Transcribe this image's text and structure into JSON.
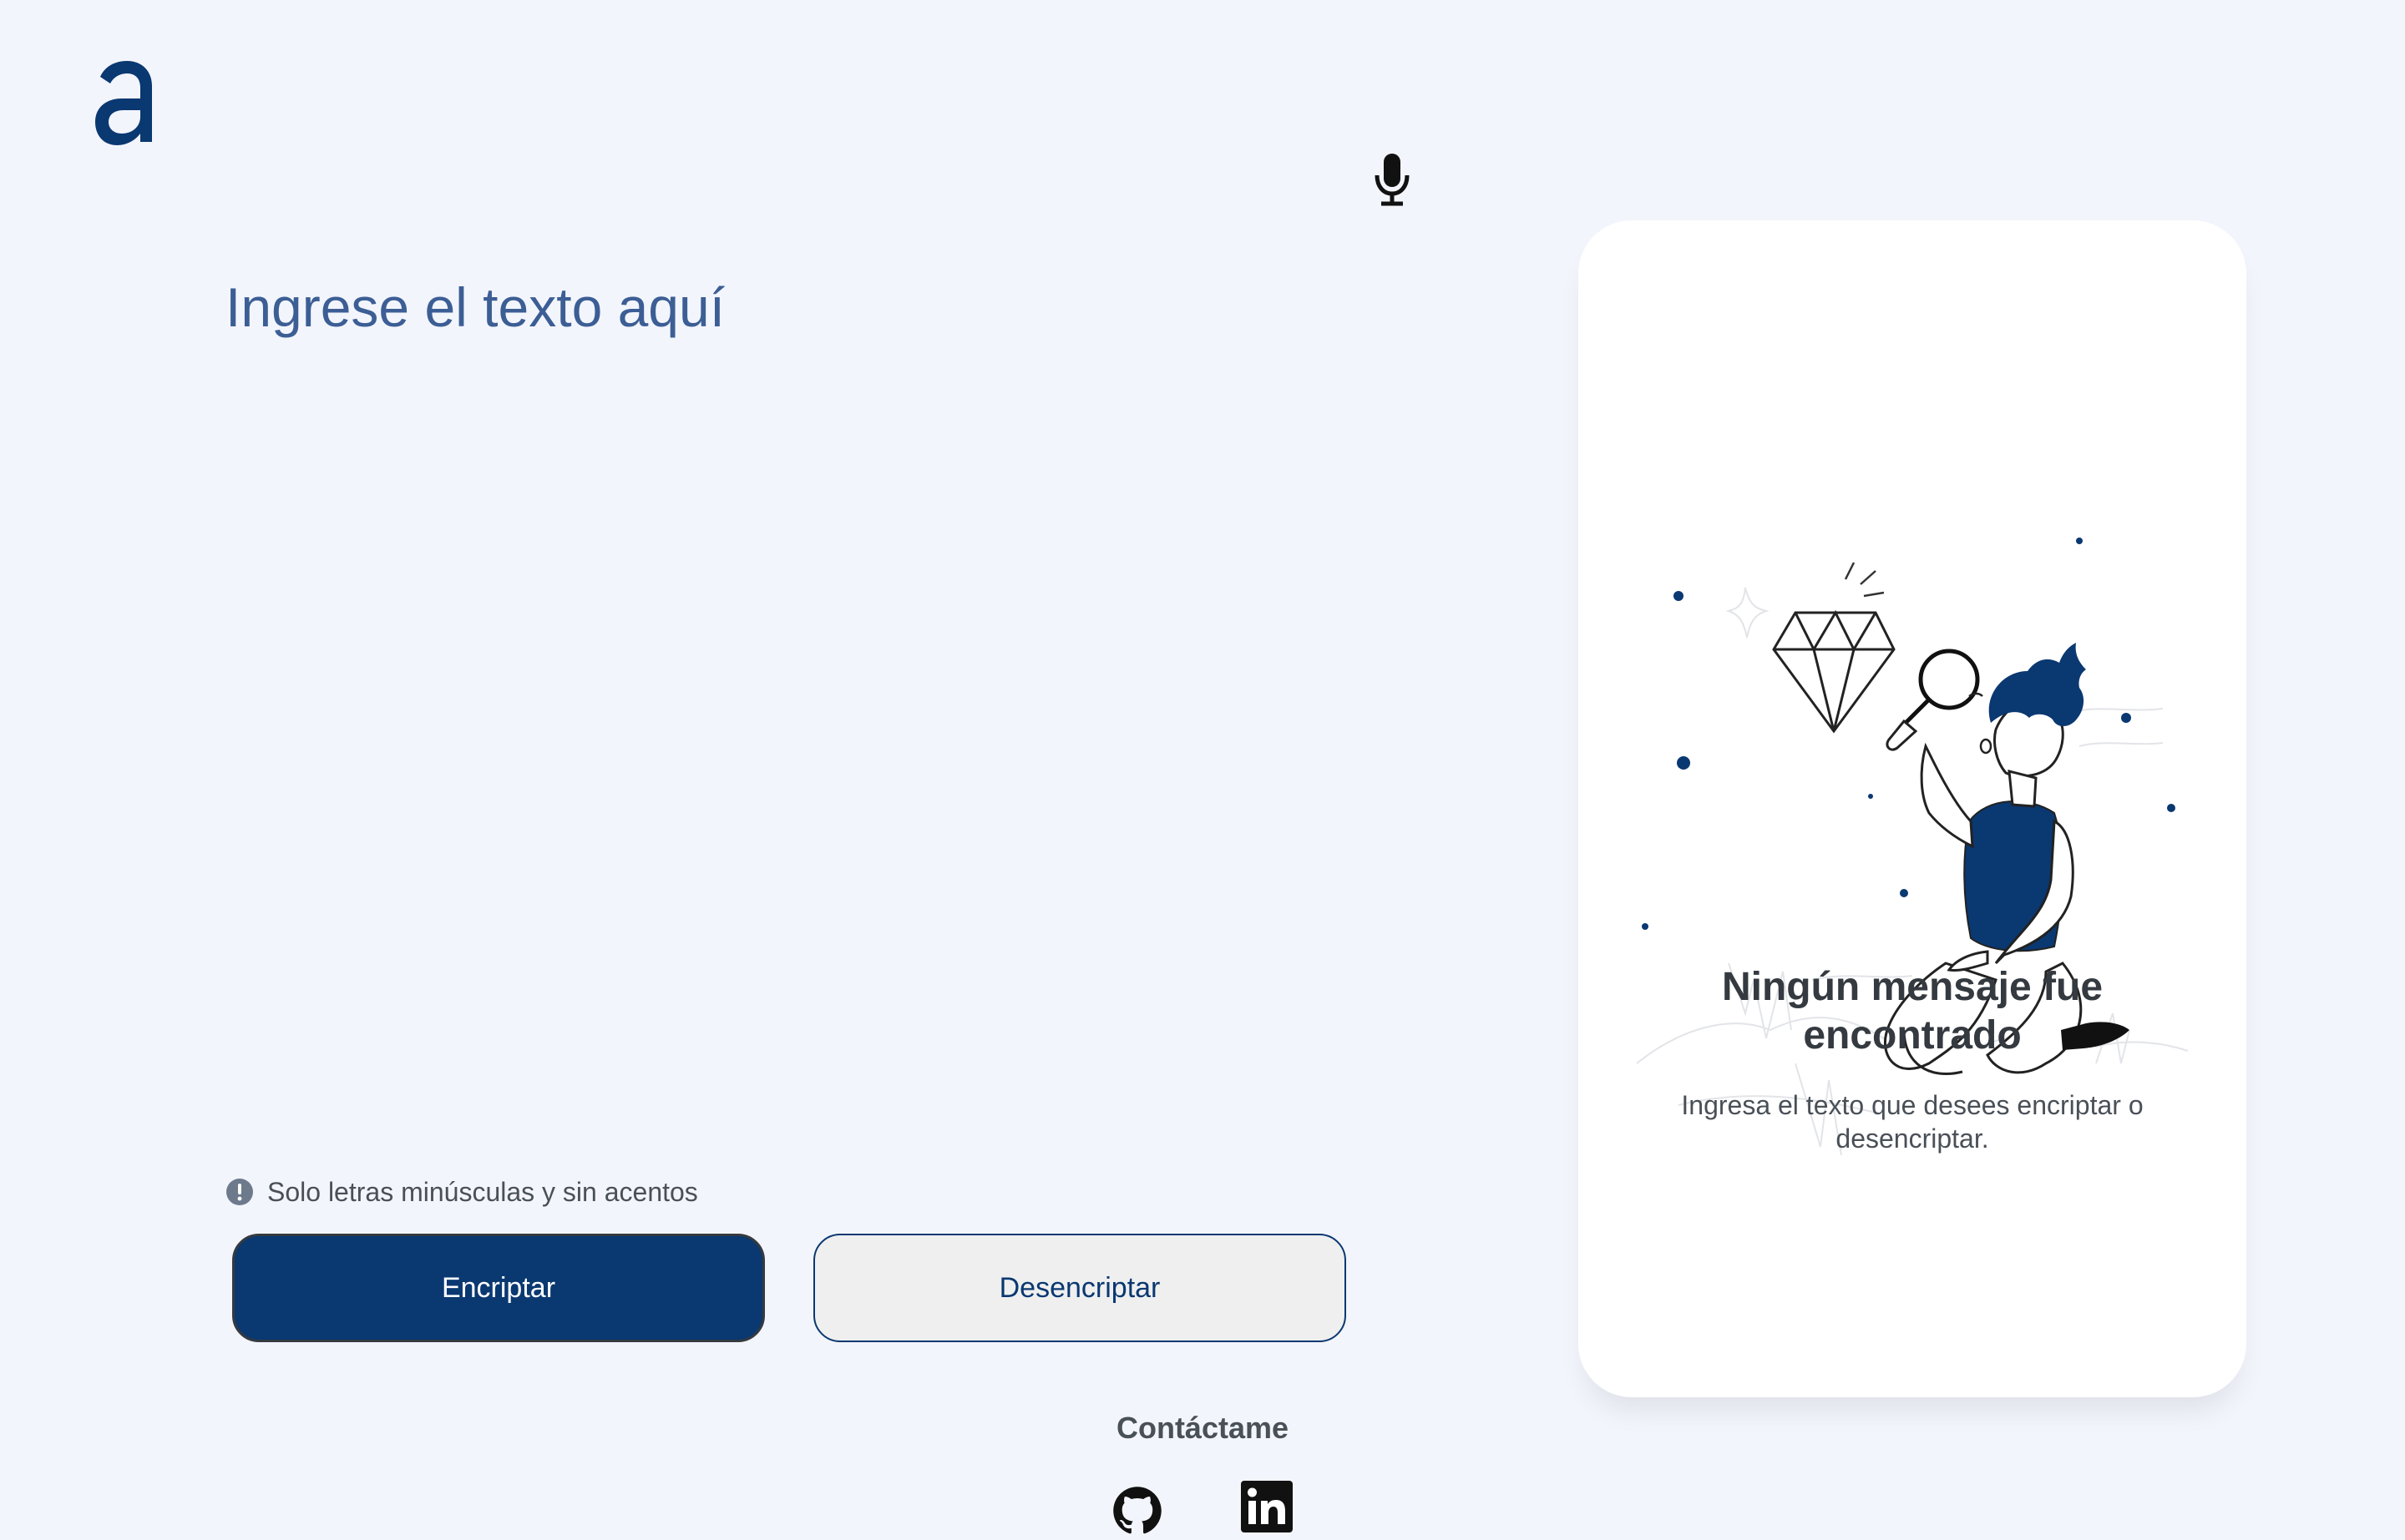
{
  "header": {
    "logo_icon": "alura-a-logo",
    "mic_icon": "microphone-icon"
  },
  "input": {
    "placeholder": "Ingrese el texto aquí",
    "value": ""
  },
  "hint": {
    "icon": "exclamation-circle-icon",
    "text": "Solo letras minúsculas y sin acentos"
  },
  "buttons": {
    "encrypt_label": "Encriptar",
    "decrypt_label": "Desencriptar"
  },
  "output_card": {
    "title": "Ningún mensaje fue encontrado",
    "description": "Ingresa el texto que desees encriptar o desencriptar."
  },
  "footer": {
    "contact_label": "Contáctame",
    "links": [
      {
        "icon": "github-icon"
      },
      {
        "icon": "linkedin-icon"
      }
    ]
  },
  "colors": {
    "background": "#F3F5FC",
    "primary": "#0A3871",
    "text_dark": "#343A40",
    "text_muted": "#495057",
    "card": "#FFFFFF"
  }
}
